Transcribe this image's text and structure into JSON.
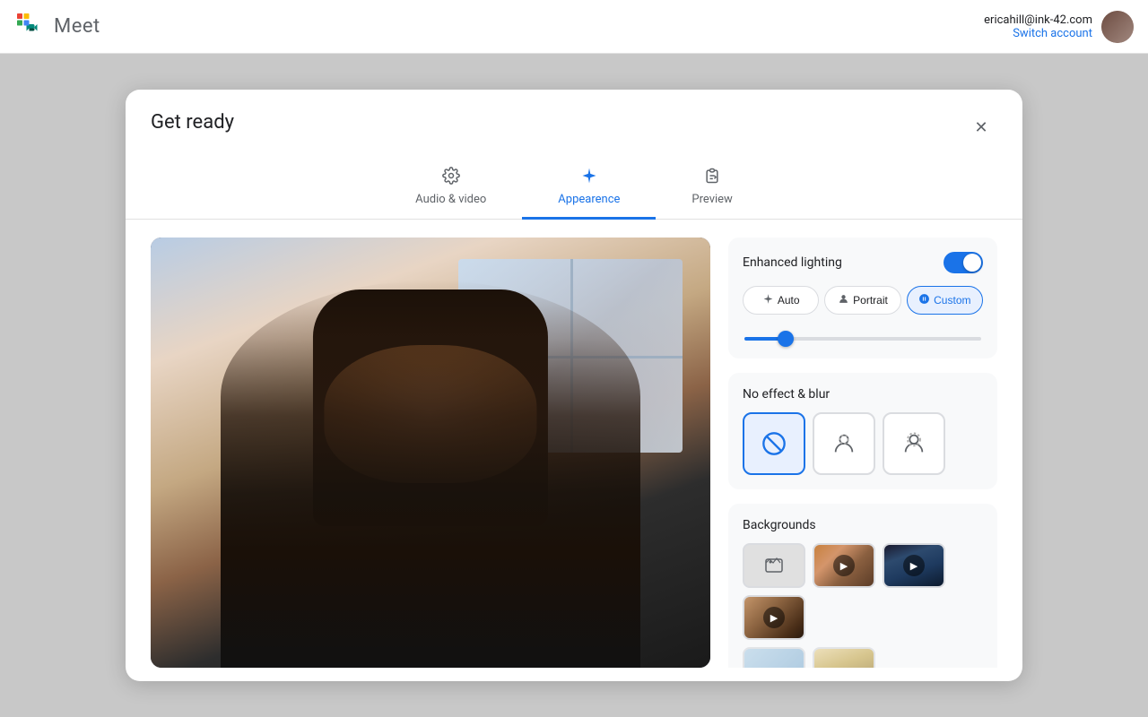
{
  "topbar": {
    "logo_alt": "Google Meet logo",
    "app_name": "Meet",
    "account_email": "ericahill@ink-42.com",
    "switch_account_label": "Switch account",
    "avatar_alt": "User avatar"
  },
  "dialog": {
    "title": "Get ready",
    "close_label": "✕",
    "tabs": [
      {
        "id": "audio-video",
        "label": "Audio & video",
        "icon": "⚙️",
        "active": false
      },
      {
        "id": "appearance",
        "label": "Appearence",
        "icon": "✦",
        "active": true
      },
      {
        "id": "preview",
        "label": "Preview",
        "icon": "📋",
        "active": false
      }
    ],
    "right_panel": {
      "lighting": {
        "label": "Enhanced lighting",
        "toggle_on": true
      },
      "mode_buttons": [
        {
          "id": "auto",
          "label": "Auto",
          "icon": "✦",
          "active": false
        },
        {
          "id": "portrait",
          "label": "Portrait",
          "icon": "👤",
          "active": false
        },
        {
          "id": "custom",
          "label": "Custom",
          "icon": "🎨",
          "active": true
        }
      ],
      "effects_section": {
        "title": "No effect & blur",
        "effects": [
          {
            "id": "none",
            "icon": "⊘",
            "active": true
          },
          {
            "id": "blur-light",
            "icon": "👤",
            "active": false
          },
          {
            "id": "blur-heavy",
            "icon": "👥",
            "active": false
          }
        ]
      },
      "backgrounds_section": {
        "title": "Backgrounds",
        "items": [
          {
            "id": "add",
            "type": "add"
          },
          {
            "id": "bg1",
            "type": "thumb1"
          },
          {
            "id": "bg2",
            "type": "thumb2"
          },
          {
            "id": "bg3",
            "type": "thumb3"
          },
          {
            "id": "bg4",
            "type": "thumb4"
          }
        ]
      }
    }
  }
}
